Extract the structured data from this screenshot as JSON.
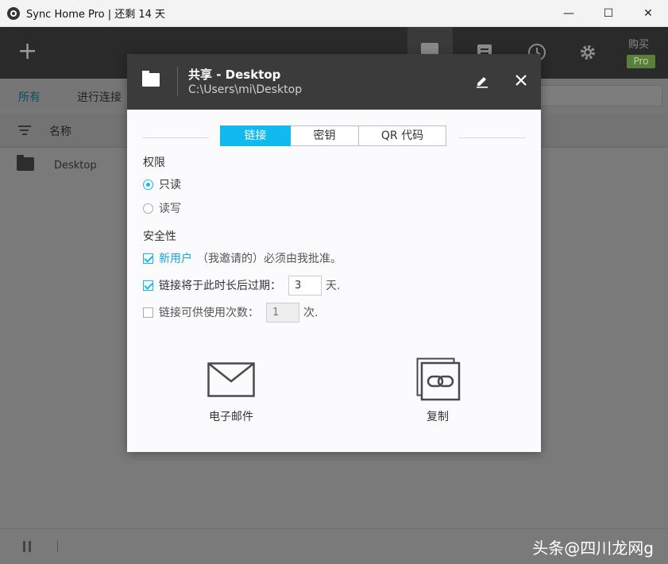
{
  "window": {
    "title": "Sync Home Pro | 还剩 14 天",
    "minimize": "—",
    "maximize": "☐",
    "close": "✕"
  },
  "toolbar": {
    "add": "+",
    "buy_label": "购买",
    "pro_badge": "Pro"
  },
  "subbar": {
    "all": "所有",
    "connect": "进行连接"
  },
  "list": {
    "column_name": "名称",
    "rows": [
      {
        "name": "Desktop"
      }
    ]
  },
  "statusbar": {
    "watermark": "头条@四川龙网g"
  },
  "modal": {
    "title": "共享 - Desktop",
    "path": "C:\\Users\\mi\\Desktop",
    "tabs": [
      {
        "label": "链接"
      },
      {
        "label": "密钥"
      },
      {
        "label": "QR 代码"
      }
    ],
    "permissions": {
      "heading": "权限",
      "read_only": "只读",
      "read_write": "读写"
    },
    "security": {
      "heading": "安全性",
      "new_user_link": "新用户",
      "new_user_rest": "（我邀请的）必须由我批准。",
      "expire_label": "链接将于此时长后过期：",
      "expire_value": "3",
      "expire_unit": "天.",
      "uses_label": "链接可供使用次数：",
      "uses_value": "1",
      "uses_unit": "次."
    },
    "actions": {
      "email": "电子邮件",
      "copy": "复制"
    }
  },
  "colors": {
    "accent": "#10b9ee",
    "modal_header": "#3b3b3b",
    "overlay": "#7a7a7a"
  }
}
